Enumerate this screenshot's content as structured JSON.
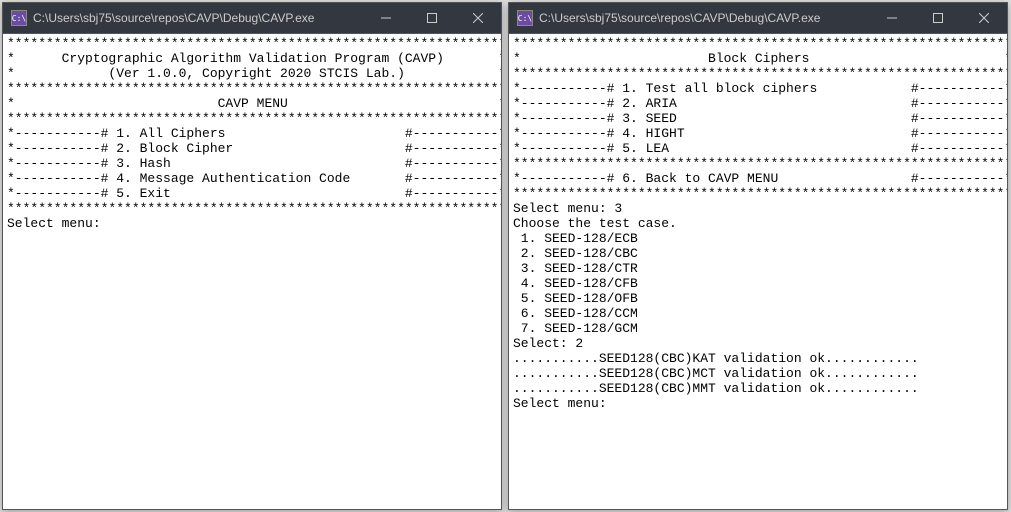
{
  "left": {
    "title": "C:\\Users\\sbj75\\source\\repos\\CAVP\\Debug\\CAVP.exe",
    "icon_label": "C:\\",
    "header_line1": "Cryptographic Algorithm Validation Program (CAVP)",
    "header_line2": "(Ver 1.0.0, Copyright 2020 STCIS Lab.)",
    "menu_title": "CAVP MENU",
    "menu_items": [
      "1. All Ciphers",
      "2. Block Cipher",
      "3. Hash",
      "4. Message Authentication Code",
      "5. Exit"
    ],
    "prompt": "Select menu: "
  },
  "right": {
    "title": "C:\\Users\\sbj75\\source\\repos\\CAVP\\Debug\\CAVP.exe",
    "icon_label": "C:\\",
    "menu_title": "Block Ciphers",
    "menu_items": [
      "1. Test all block ciphers",
      "2. ARIA",
      "3. SEED",
      "4. HIGHT",
      "5. LEA"
    ],
    "back_item": "6. Back to CAVP MENU",
    "select_menu_prompt": "Select menu: ",
    "select_menu_value": "3",
    "choose_line": "Choose the test case.",
    "test_cases": [
      "1. SEED-128/ECB",
      "2. SEED-128/CBC",
      "3. SEED-128/CTR",
      "4. SEED-128/CFB",
      "5. SEED-128/OFB",
      "6. SEED-128/CCM",
      "7. SEED-128/GCM"
    ],
    "select_prompt": "Select: ",
    "select_value": "2",
    "results": [
      "...........SEED128(CBC)KAT validation ok............",
      "...........SEED128(CBC)MCT validation ok............",
      "...........SEED128(CBC)MMT validation ok............"
    ],
    "final_prompt": "Select menu: "
  }
}
